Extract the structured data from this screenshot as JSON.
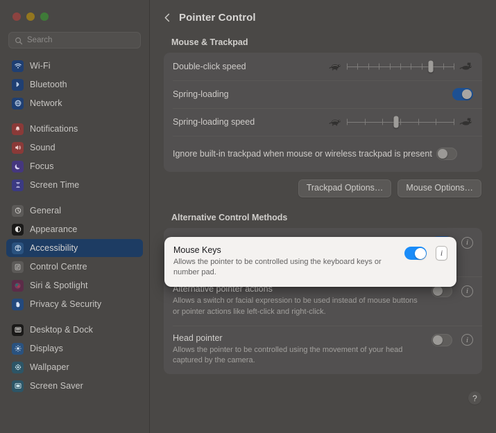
{
  "window": {
    "traffic_lights": [
      "close",
      "minimize",
      "zoom"
    ]
  },
  "sidebar": {
    "search": {
      "placeholder": "Search",
      "value": ""
    },
    "groups": [
      {
        "items": [
          {
            "label": "Wi-Fi",
            "icon": "wifi-icon",
            "tint": "ic-blue",
            "glyph": "◔",
            "selected": false
          },
          {
            "label": "Bluetooth",
            "icon": "bluetooth-icon",
            "tint": "ic-blue",
            "glyph": "ᛦ",
            "selected": false
          },
          {
            "label": "Network",
            "icon": "network-icon",
            "tint": "ic-blue",
            "glyph": "ἱ0",
            "selected": false
          }
        ]
      },
      {
        "items": [
          {
            "label": "Notifications",
            "icon": "bell-icon",
            "tint": "ic-red",
            "glyph": "▲",
            "selected": false
          },
          {
            "label": "Sound",
            "icon": "speaker-icon",
            "tint": "ic-red",
            "glyph": "◀",
            "selected": false
          },
          {
            "label": "Focus",
            "icon": "moon-icon",
            "tint": "ic-purple",
            "glyph": "☾",
            "selected": false
          },
          {
            "label": "Screen Time",
            "icon": "hourglass-icon",
            "tint": "ic-indigo",
            "glyph": "⧗",
            "selected": false
          }
        ]
      },
      {
        "items": [
          {
            "label": "General",
            "icon": "gear-icon",
            "tint": "ic-grey",
            "glyph": "⚙",
            "selected": false
          },
          {
            "label": "Appearance",
            "icon": "appearance-icon",
            "tint": "ic-black",
            "glyph": "◑",
            "selected": false
          },
          {
            "label": "Accessibility",
            "icon": "accessibility-icon",
            "tint": "ic-ltblue",
            "glyph": "Ⓙ",
            "selected": true
          },
          {
            "label": "Control Centre",
            "icon": "control-centre-icon",
            "tint": "ic-grey",
            "glyph": "▤",
            "selected": false
          },
          {
            "label": "Siri & Spotlight",
            "icon": "siri-icon",
            "tint": "ic-siri",
            "glyph": "●",
            "selected": false
          },
          {
            "label": "Privacy & Security",
            "icon": "hand-icon",
            "tint": "ic-hand",
            "glyph": "✋",
            "selected": false
          }
        ]
      },
      {
        "items": [
          {
            "label": "Desktop & Dock",
            "icon": "desktop-dock-icon",
            "tint": "ic-black",
            "glyph": "▣",
            "selected": false
          },
          {
            "label": "Displays",
            "icon": "display-icon",
            "tint": "ic-ltblue",
            "glyph": "☀",
            "selected": false
          },
          {
            "label": "Wallpaper",
            "icon": "wallpaper-icon",
            "tint": "ic-teal",
            "glyph": "❀",
            "selected": false
          },
          {
            "label": "Screen Saver",
            "icon": "screen-saver-icon",
            "tint": "ic-teal",
            "glyph": "▧",
            "selected": false
          }
        ]
      }
    ]
  },
  "header": {
    "back_icon": "chevron-left-icon",
    "title": "Pointer Control"
  },
  "sections": [
    {
      "heading": "Mouse & Trackpad",
      "rows": [
        {
          "type": "slider",
          "label": "Double-click speed",
          "left_icon": "turtle-icon",
          "right_icon": "rabbit-icon",
          "ticks": 10,
          "value_pct": 78
        },
        {
          "type": "switch",
          "label": "Spring-loading",
          "on": true
        },
        {
          "type": "slider",
          "label": "Spring-loading speed",
          "left_icon": "turtle-icon",
          "right_icon": "rabbit-icon",
          "ticks": 6,
          "value_pct": 46
        },
        {
          "type": "switch",
          "label": "Ignore built-in trackpad when mouse or wireless trackpad is present",
          "on": false
        }
      ],
      "buttons": [
        {
          "label": "Trackpad Options…"
        },
        {
          "label": "Mouse Options…"
        }
      ]
    },
    {
      "heading": "Alternative Control Methods",
      "items": [
        {
          "title": "Mouse Keys",
          "subtitle": "Allows the pointer to be controlled using the keyboard keys or number pad.",
          "on": true,
          "info_icon": "info-icon",
          "highlighted": true
        },
        {
          "title": "Alternative pointer actions",
          "subtitle": "Allows a switch or facial expression to be used instead of mouse buttons or pointer actions like left-click and right-click.",
          "on": false,
          "info_icon": "info-icon",
          "highlighted": false
        },
        {
          "title": "Head pointer",
          "subtitle": "Allows the pointer to be controlled using the movement of your head captured by the camera.",
          "on": false,
          "info_icon": "info-icon",
          "highlighted": false
        }
      ]
    }
  ],
  "help": {
    "label": "?",
    "icon": "question-mark-icon"
  },
  "colors": {
    "accent_blue": "#1a8cf8",
    "selected_sidebar": "#1d3c63",
    "spotlight_card": "#f4f2f0",
    "window_bg": "#4a4846"
  }
}
